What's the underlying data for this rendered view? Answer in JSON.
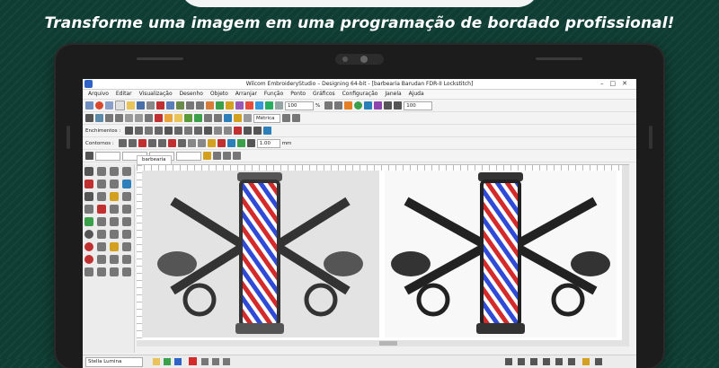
{
  "headline": "Transforme uma imagem em uma programação de bordado profissional!",
  "app": {
    "title": "Wilcom EmbroideryStudio – Designing 64-bit - [barbearia    Barudan FDR-II Lockstitch]"
  },
  "menu": [
    "Arquivo",
    "Editar",
    "Visualização",
    "Desenho",
    "Objeto",
    "Arranjar",
    "Função",
    "Ponto",
    "Gráficos",
    "Configuração",
    "Janela",
    "Ajuda"
  ],
  "toolbar": {
    "zoom_value": "100",
    "zoom_unit": "%",
    "metric_select": "Métrica",
    "preenchimentos_label": "Enchimentos :",
    "contornos_label": "Contornos :",
    "width_value": "1.00",
    "width_unit": "mm",
    "zoom_value_2": "100"
  },
  "document_tab": "barbearia",
  "status": {
    "font_field": "Stella Lumina"
  },
  "colors": {
    "background": "#0f3d33",
    "accent_red": "#d42a2a",
    "accent_blue": "#2f4ad6"
  }
}
